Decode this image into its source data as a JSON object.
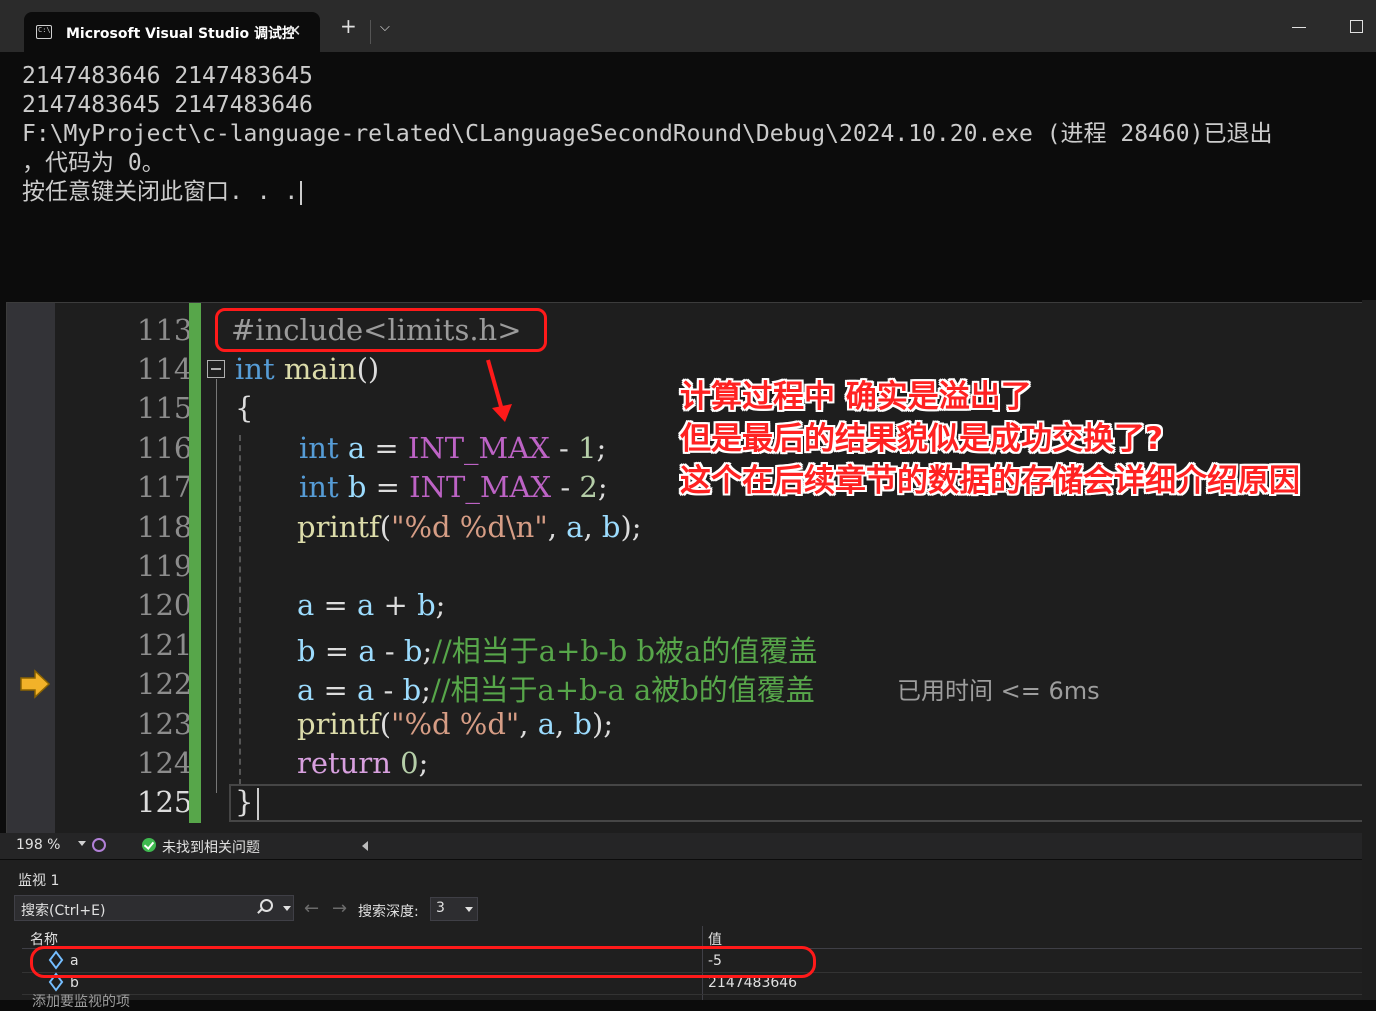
{
  "terminal": {
    "tab_title": "Microsoft Visual Studio 调试控",
    "tab_close": "✕",
    "new_tab": "+",
    "dropdown": "⌵",
    "output_lines": [
      "2147483646 2147483645",
      "2147483645 2147483646",
      "F:\\MyProject\\c-language-related\\CLanguageSecondRound\\Debug\\2024.10.20.exe (进程 28460)已退出",
      "，代码为 0。",
      "按任意键关闭此窗口. . ."
    ]
  },
  "editor": {
    "line_numbers": [
      "113",
      "114",
      "115",
      "116",
      "117",
      "118",
      "119",
      "120",
      "121",
      "122",
      "123",
      "124",
      "125"
    ],
    "lines": {
      "l113": "#include<limits.h>",
      "l114_kw": "int",
      "l114_fn": " main",
      "l114_rest": "()",
      "l115": "{",
      "l116_kw": "int",
      "l116_var": " a",
      "l116_eq": " = ",
      "l116_mac": "INT_MAX",
      "l116_op": " - ",
      "l116_num": "1",
      "l116_end": ";",
      "l117_kw": "int",
      "l117_var": " b",
      "l117_eq": " = ",
      "l117_mac": "INT_MAX",
      "l117_op": " - ",
      "l117_num": "2",
      "l117_end": ";",
      "l118_fn": "printf",
      "l118_p1": "(",
      "l118_str": "\"%d %d\\n\"",
      "l118_c1": ", ",
      "l118_a": "a",
      "l118_c2": ", ",
      "l118_b": "b",
      "l118_end": ");",
      "l120_v1": "a",
      "l120_eq": " = ",
      "l120_v2": "a",
      "l120_op": " + ",
      "l120_v3": "b",
      "l120_end": ";",
      "l121_v1": "b",
      "l121_eq": " = ",
      "l121_v2": "a",
      "l121_op": " - ",
      "l121_v3": "b",
      "l121_end": ";",
      "l121_cm": "//相当于a+b-b b被a的值覆盖",
      "l122_v1": "a",
      "l122_eq": " = ",
      "l122_v2": "a",
      "l122_op": " - ",
      "l122_v3": "b",
      "l122_end": ";",
      "l122_cm": "//相当于a+b-a a被b的值覆盖",
      "l123_fn": "printf",
      "l123_p1": "(",
      "l123_str": "\"%d %d\"",
      "l123_c1": ", ",
      "l123_a": "a",
      "l123_c2": ", ",
      "l123_b": "b",
      "l123_end": ");",
      "l124_kw": "return",
      "l124_num": " 0",
      "l124_end": ";",
      "l125": "}"
    },
    "perf_tip": "已用时间 <= 6ms"
  },
  "annotation": {
    "line1": "计算过程中 确实是溢出了",
    "line2": "但是最后的结果貌似是成功交换了?",
    "line3": "这个在后续章节的数据的存储会详细介绍原因"
  },
  "status": {
    "zoom": "198 %",
    "issues": "未找到相关问题"
  },
  "watch": {
    "title": "监视 1",
    "search_placeholder": "搜索(Ctrl+E)",
    "nav_back": "←",
    "nav_forward": "→",
    "depth_label": "搜索深度:",
    "depth_value": "3",
    "col_name": "名称",
    "col_value": "值",
    "rows": [
      {
        "name": "a",
        "value": "-5"
      },
      {
        "name": "b",
        "value": "2147483646"
      }
    ],
    "add_item": "添加要监视的项"
  },
  "colors": {
    "keyword": "#569cd6",
    "function": "#dcdcaa",
    "macro": "#bd63c5",
    "string": "#d69d85",
    "variable": "#9cdcfe",
    "comment": "#57a64a",
    "annotation_red": "#ff2222",
    "change_bar": "#57a64a"
  },
  "icons": [
    "terminal-icon",
    "close-icon",
    "plus-icon",
    "chevron-down-icon",
    "minimize-icon",
    "maximize-icon",
    "current-line-arrow-icon",
    "collapse-icon",
    "check-circle-icon",
    "search-icon",
    "variable-icon"
  ]
}
